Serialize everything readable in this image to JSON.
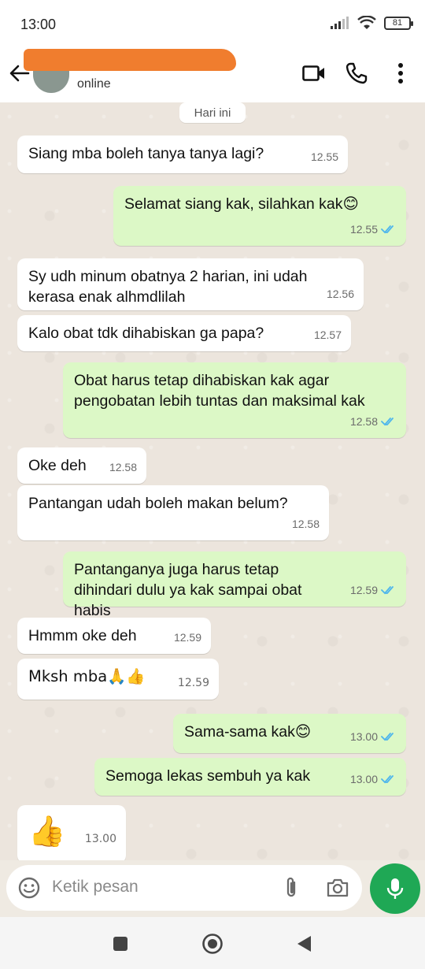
{
  "status_bar": {
    "time": "13:00",
    "battery": "81"
  },
  "header": {
    "contact_status": "online"
  },
  "chat": {
    "date_label": "Hari ini",
    "messages": [
      {
        "dir": "in",
        "text": "Siang mba boleh tanya tanya lagi?",
        "time": "12.55"
      },
      {
        "dir": "out",
        "text": "Selamat siang kak, silahkan kak😊",
        "time": "12.55",
        "read": true
      },
      {
        "dir": "in",
        "text": "Sy udh minum obatnya 2 harian, ini udah kerasa enak alhmdlilah",
        "time": "12.56"
      },
      {
        "dir": "in",
        "text": "Kalo obat tdk dihabiskan ga papa?",
        "time": "12.57"
      },
      {
        "dir": "out",
        "text": "Obat harus tetap dihabiskan kak agar pengobatan lebih tuntas dan maksimal kak",
        "time": "12.58",
        "read": true
      },
      {
        "dir": "in",
        "text": "Oke deh",
        "time": "12.58"
      },
      {
        "dir": "in",
        "text": "Pantangan udah boleh makan belum?",
        "time": "12.58"
      },
      {
        "dir": "out",
        "text": "Pantanganya juga harus tetap dihindari dulu ya kak sampai obat habis",
        "time": "12.59",
        "read": true
      },
      {
        "dir": "in",
        "text": "Hmmm oke deh",
        "time": "12.59"
      },
      {
        "dir": "in",
        "text": "Mksh mba🙏👍",
        "time": "12.59"
      },
      {
        "dir": "out",
        "text": "Sama-sama kak😊",
        "time": "13.00",
        "read": true
      },
      {
        "dir": "out",
        "text": "Semoga lekas sembuh ya kak",
        "time": "13.00",
        "read": true
      },
      {
        "dir": "in",
        "text": "👍",
        "time": "13.00"
      }
    ]
  },
  "composer": {
    "placeholder": "Ketik pesan"
  },
  "icons": {
    "back": "arrow-left-icon",
    "video": "video-call-icon",
    "call": "phone-icon",
    "menu": "more-vertical-icon",
    "emoji": "emoji-icon",
    "attach": "paperclip-icon",
    "camera": "camera-icon",
    "mic": "microphone-icon",
    "read_receipt": "double-check-icon"
  },
  "colors": {
    "incoming_bubble": "#ffffff",
    "outgoing_bubble": "#dcf8c6",
    "read_tick": "#4fb6ec",
    "mic_button": "#1fa855",
    "redaction": "#f07d2e"
  }
}
